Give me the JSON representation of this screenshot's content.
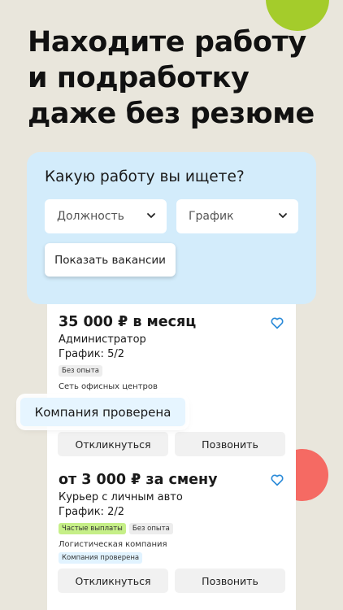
{
  "headline": {
    "line1": "Находите работу",
    "line2": "и подработку",
    "line3": "даже без резюме"
  },
  "search": {
    "title": "Какую работу вы ищете?",
    "position_select": "Должность",
    "schedule_select": "График",
    "show_button": "Показать вакансии"
  },
  "verified_popup": "Компания проверена",
  "vacancies": [
    {
      "salary": "35 000 ₽ в месяц",
      "role": "Администратор",
      "schedule": "График: 5/2",
      "tags": [
        "Без опыта"
      ],
      "company": "Сеть офисных центров",
      "respond": "Откликнуться",
      "call": "Позвонить"
    },
    {
      "salary": "от 3 000 ₽ за смену",
      "role": "Курьер с личным авто",
      "schedule": "График: 2/2",
      "tags": [
        "Частые выплаты",
        "Без опыта"
      ],
      "company": "Логистическая компания",
      "verified_badge": "Компания проверена",
      "respond": "Откликнуться",
      "call": "Позвонить"
    }
  ],
  "colors": {
    "background": "#e9e6dc",
    "search_panel": "#d3ecfb",
    "accent_blue": "#2a8ad8",
    "blob_green": "#a4cc2b",
    "blob_red": "#f56a63",
    "tag_green": "#c6ef88"
  },
  "icons": {
    "select_arrow": "chevron-down-icon",
    "favorite": "heart-outline-icon"
  }
}
